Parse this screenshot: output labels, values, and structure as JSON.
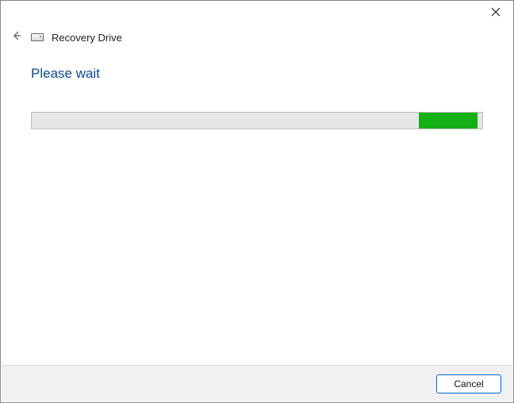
{
  "titlebar": {
    "close_icon": "close"
  },
  "header": {
    "back_icon": "back",
    "drive_icon": "drive",
    "title": "Recovery Drive"
  },
  "content": {
    "status_text": "Please wait",
    "progress": {
      "indeterminate": true,
      "chunk_left_percent": 86,
      "chunk_width_percent": 13,
      "track_color": "#e6e6e6",
      "chunk_color": "#15b015"
    }
  },
  "footer": {
    "cancel_label": "Cancel"
  }
}
